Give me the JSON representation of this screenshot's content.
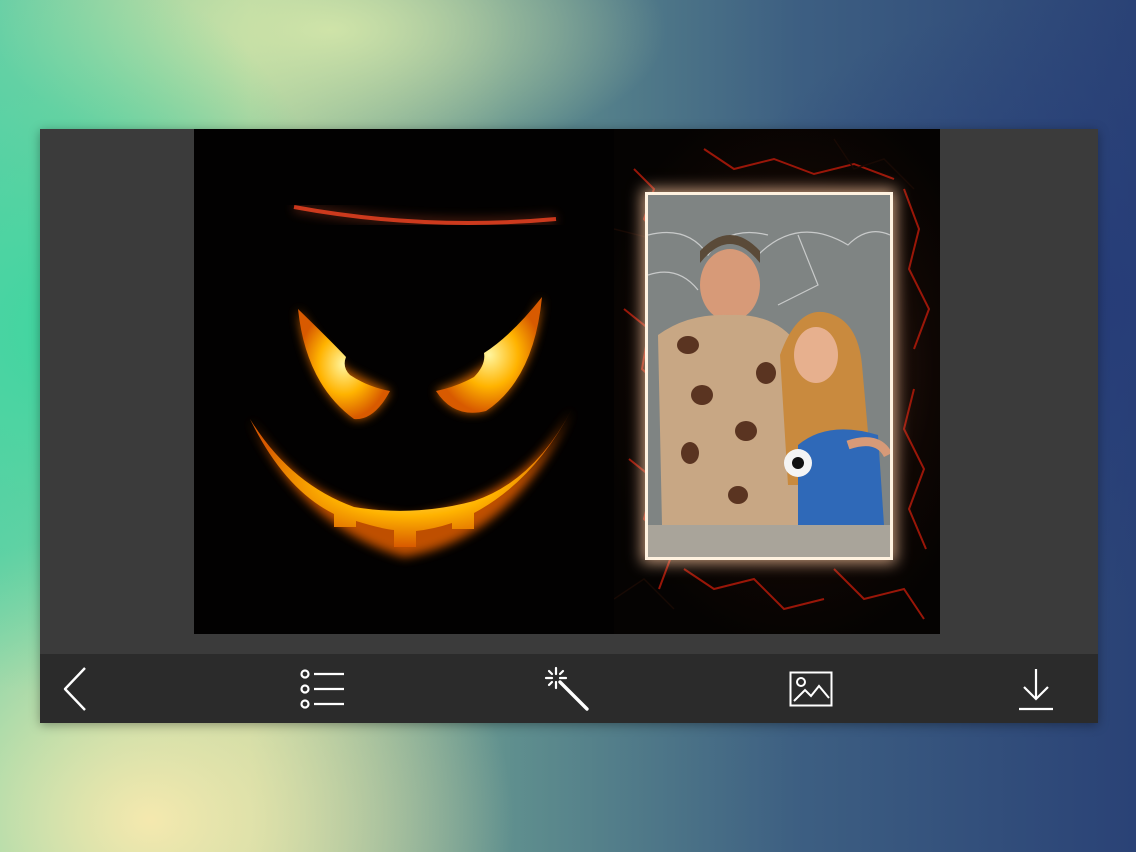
{
  "toolbar": {
    "buttons": [
      {
        "name": "back-button",
        "icon": "chevron-left-icon"
      },
      {
        "name": "frame-list-button",
        "icon": "list-icon"
      },
      {
        "name": "effects-button",
        "icon": "magic-wand-icon"
      },
      {
        "name": "gallery-button",
        "icon": "image-icon"
      },
      {
        "name": "download-button",
        "icon": "download-icon"
      }
    ]
  },
  "canvas": {
    "left_image": "jack-o-lantern",
    "frame_style": "cracked-glow",
    "photo": "couple-in-costumes"
  },
  "colors": {
    "card_bg": "#3b3b3b",
    "toolbar_bg": "#2b2b2b",
    "icon_color": "#ffffff",
    "pumpkin_glow": "#ffb400"
  }
}
